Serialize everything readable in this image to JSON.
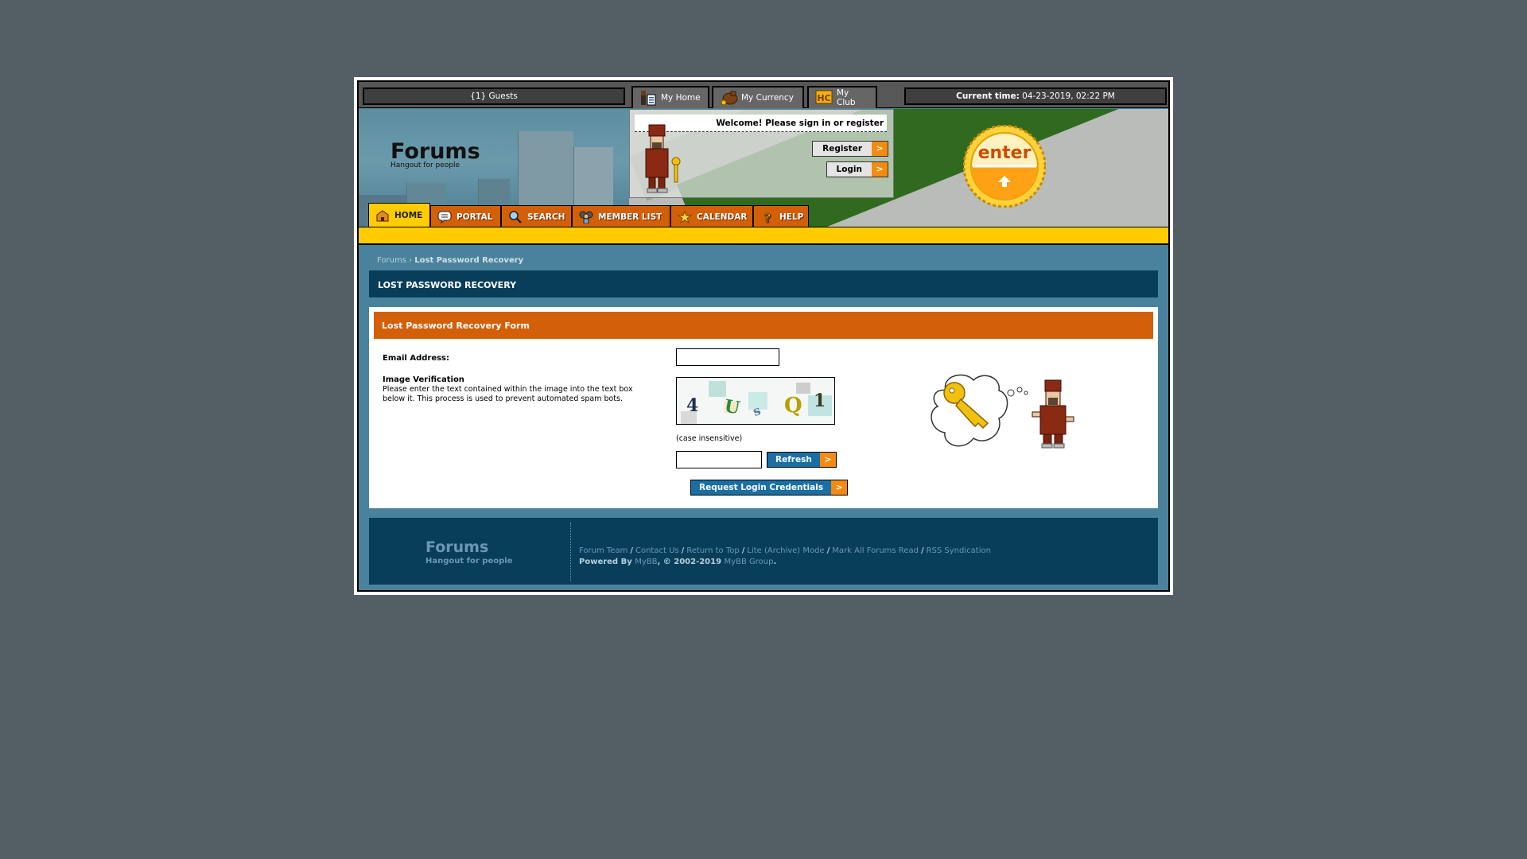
{
  "topbar": {
    "guests": "{1} Guests",
    "tabs": [
      {
        "label": "My Home",
        "icon": "home-user-icon"
      },
      {
        "label": "My Currency",
        "icon": "currency-bag-icon"
      },
      {
        "label": "My Club",
        "icon": "hc-club-icon"
      }
    ],
    "current_time_label": "Current time:",
    "current_time_value": "04-23-2019, 02:22 PM"
  },
  "header": {
    "title": "Forums",
    "subtitle": "Hangout for people",
    "welcome": "Welcome! Please sign in or register",
    "register_label": "Register",
    "login_label": "Login",
    "arrow": ">",
    "enter_badge": "enter"
  },
  "nav": {
    "items": [
      {
        "label": "HOME",
        "icon": "house-icon",
        "active": true
      },
      {
        "label": "PORTAL",
        "icon": "speech-bubble-icon"
      },
      {
        "label": "SEARCH",
        "icon": "magnifier-icon"
      },
      {
        "label": "MEMBER LIST",
        "icon": "members-icon"
      },
      {
        "label": "CALENDAR",
        "icon": "star-icon"
      },
      {
        "label": "HELP",
        "icon": "question-icon"
      }
    ]
  },
  "breadcrumb": {
    "root": "Forums",
    "separator": "›",
    "current": "Lost Password Recovery"
  },
  "page_title": "LOST PASSWORD RECOVERY",
  "form": {
    "heading": "Lost Password Recovery Form",
    "email_label": "Email Address:",
    "email_value": "",
    "verification_label": "Image Verification",
    "verification_desc": "Please enter the text contained within the image into the text box below it. This process is used to prevent automated spam bots.",
    "captcha_chars": [
      "4",
      "U",
      "s",
      "Q",
      "1"
    ],
    "case_note": "(case insensitive)",
    "captcha_value": "",
    "refresh_label": "Refresh",
    "submit_label": "Request Login Credentials",
    "arrow": ">"
  },
  "footer": {
    "title": "Forums",
    "subtitle": "Hangout for people",
    "links": [
      "Forum Team",
      "Contact Us",
      "Return to Top",
      "Lite (Archive) Mode",
      "Mark All Forums Read",
      "RSS Syndication"
    ],
    "separator": "/",
    "powered_by": "Powered By",
    "mybb": "MyBB",
    "copyright": ", © 2002-2019",
    "mybb_group": "MyBB Group",
    "period": "."
  },
  "colors": {
    "background": "#535e65",
    "content_bg": "#4a829c",
    "dark_bar": "#093e5a",
    "orange": "#d35f08",
    "yellow": "#ffcc00",
    "button_blue": "#1a6fa5",
    "arrow_orange": "#f58a10"
  }
}
